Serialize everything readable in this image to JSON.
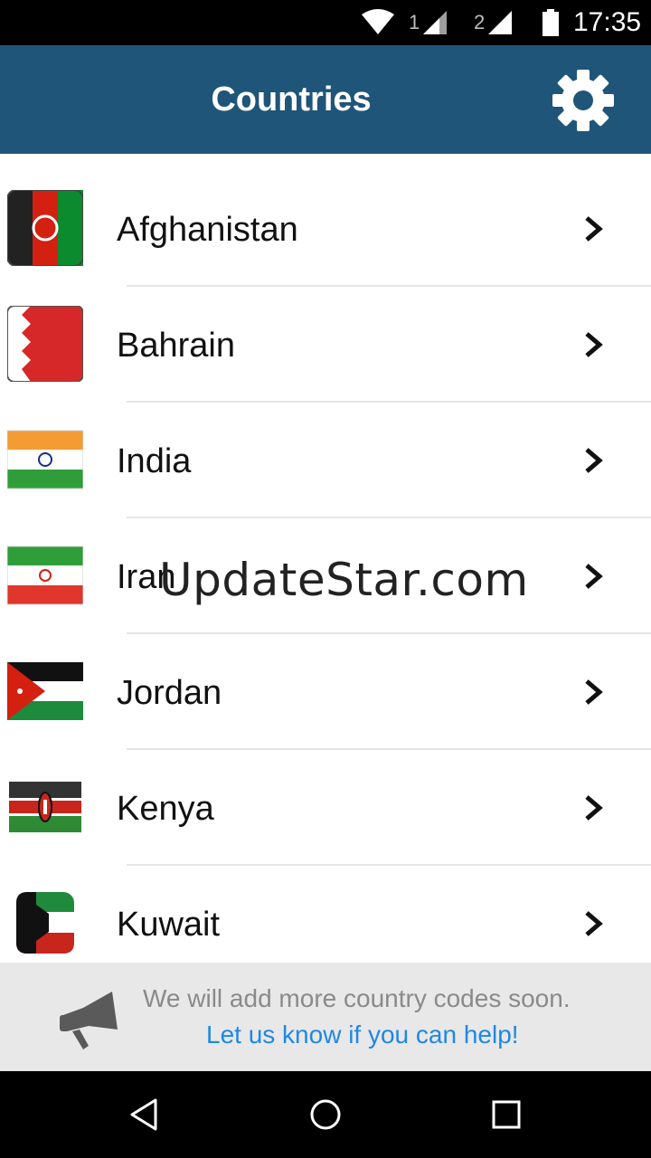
{
  "status_bar": {
    "time": "17:35",
    "sim1": "1",
    "sim2": "2"
  },
  "app_bar": {
    "title": "Countries",
    "settings_icon": "gear-icon"
  },
  "countries": [
    {
      "name": "Afghanistan"
    },
    {
      "name": "Bahrain"
    },
    {
      "name": "India"
    },
    {
      "name": "Iran"
    },
    {
      "name": "Jordan"
    },
    {
      "name": "Kenya"
    },
    {
      "name": "Kuwait"
    }
  ],
  "watermark": "UpdateStar.com",
  "footer": {
    "message": "We will add more country codes soon.",
    "link": "Let us know if you can help!",
    "icon": "megaphone-icon"
  },
  "colors": {
    "app_bar": "#1f5578",
    "link": "#1e88e5",
    "footer_bg": "#e8e8e8"
  }
}
